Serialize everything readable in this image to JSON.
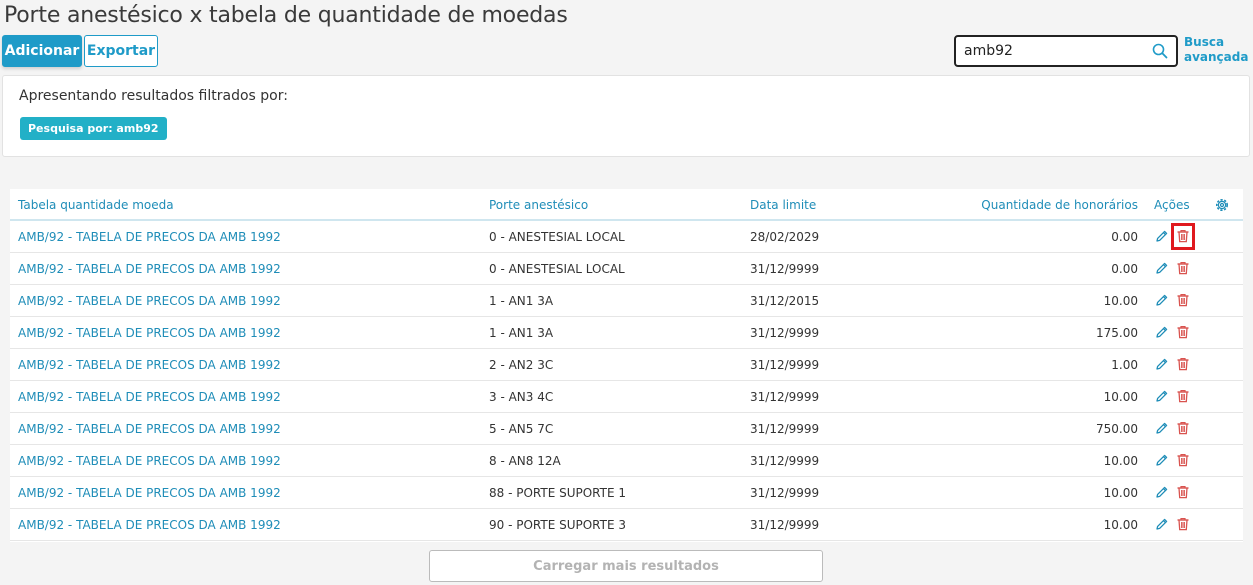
{
  "page": {
    "title": "Porte anestésico x tabela de quantidade de moedas"
  },
  "toolbar": {
    "add_label": "Adicionar",
    "export_label": "Exportar"
  },
  "search": {
    "value": "amb92",
    "advanced_line1": "Busca",
    "advanced_line2": "avançada"
  },
  "filter": {
    "label": "Apresentando resultados filtrados por:",
    "chip": "Pesquisa por: amb92"
  },
  "table": {
    "headers": {
      "tabela": "Tabela quantidade moeda",
      "porte": "Porte anestésico",
      "data": "Data limite",
      "quantidade": "Quantidade de honorários",
      "acoes": "Ações"
    },
    "rows": [
      {
        "tabela": "AMB/92 - TABELA DE PRECOS DA AMB 1992",
        "porte": "0 - ANESTESIAL LOCAL",
        "data": "28/02/2029",
        "quantidade": "0.00"
      },
      {
        "tabela": "AMB/92 - TABELA DE PRECOS DA AMB 1992",
        "porte": "0 - ANESTESIAL LOCAL",
        "data": "31/12/9999",
        "quantidade": "0.00"
      },
      {
        "tabela": "AMB/92 - TABELA DE PRECOS DA AMB 1992",
        "porte": "1 - AN1 3A",
        "data": "31/12/2015",
        "quantidade": "10.00"
      },
      {
        "tabela": "AMB/92 - TABELA DE PRECOS DA AMB 1992",
        "porte": "1 - AN1 3A",
        "data": "31/12/9999",
        "quantidade": "175.00"
      },
      {
        "tabela": "AMB/92 - TABELA DE PRECOS DA AMB 1992",
        "porte": "2 - AN2 3C",
        "data": "31/12/9999",
        "quantidade": "1.00"
      },
      {
        "tabela": "AMB/92 - TABELA DE PRECOS DA AMB 1992",
        "porte": "3 - AN3 4C",
        "data": "31/12/9999",
        "quantidade": "10.00"
      },
      {
        "tabela": "AMB/92 - TABELA DE PRECOS DA AMB 1992",
        "porte": "5 - AN5 7C",
        "data": "31/12/9999",
        "quantidade": "750.00"
      },
      {
        "tabela": "AMB/92 - TABELA DE PRECOS DA AMB 1992",
        "porte": "8 - AN8 12A",
        "data": "31/12/9999",
        "quantidade": "10.00"
      },
      {
        "tabela": "AMB/92 - TABELA DE PRECOS DA AMB 1992",
        "porte": "88 - PORTE SUPORTE 1",
        "data": "31/12/9999",
        "quantidade": "10.00"
      },
      {
        "tabela": "AMB/92 - TABELA DE PRECOS DA AMB 1992",
        "porte": "90 - PORTE SUPORTE 3",
        "data": "31/12/9999",
        "quantidade": "10.00"
      }
    ]
  },
  "load_more_label": "Carregar mais resultados",
  "icons": {
    "search": "search-icon",
    "settings": "gear-icon",
    "edit": "pencil-icon",
    "delete": "trash-icon"
  },
  "colors": {
    "primary": "#1f9bc8",
    "link": "#1f8db8",
    "chip": "#22b0c7",
    "delete": "#d9534f",
    "highlight": "#e0191e"
  }
}
